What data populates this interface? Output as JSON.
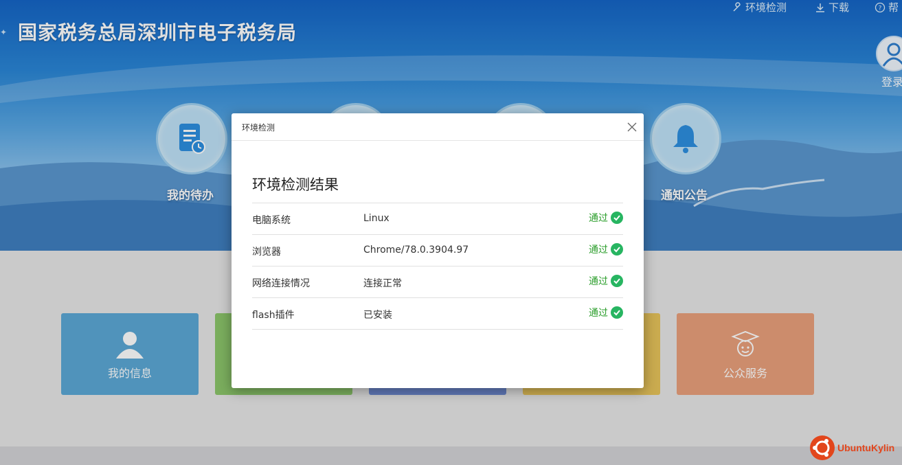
{
  "header": {
    "site_title": "国家税务总局深圳市电子税务局",
    "links": [
      {
        "label": "环境检测",
        "icon": "wrench-icon"
      },
      {
        "label": "下载",
        "icon": "download-icon"
      },
      {
        "label": "帮",
        "icon": "help-icon"
      }
    ],
    "login_label": "登录"
  },
  "shortcuts": [
    {
      "label": "我的待办",
      "icon": "document-clock-icon"
    },
    {
      "label": "",
      "icon": "hidden-shortcut-icon"
    },
    {
      "label": "",
      "icon": "hidden-shortcut-icon"
    },
    {
      "label": "通知公告",
      "icon": "bell-icon"
    }
  ],
  "tiles": [
    {
      "label": "我的信息",
      "color": "#5ca8d5",
      "icon": "user-icon"
    },
    {
      "label": "",
      "color": "#8bc56a"
    },
    {
      "label": "",
      "color": "#6d88cf"
    },
    {
      "label": "",
      "color": "#e6c35a"
    },
    {
      "label": "公众服务",
      "color": "#e9a07c",
      "icon": "graduate-icon"
    }
  ],
  "dialog": {
    "title": "环境检测",
    "result_title": "环境检测结果",
    "rows": [
      {
        "name": "电脑系统",
        "value": "Linux",
        "status": "通过"
      },
      {
        "name": "浏览器",
        "value": "Chrome/78.0.3904.97",
        "status": "通过"
      },
      {
        "name": "网络连接情况",
        "value": "连接正常",
        "status": "通过"
      },
      {
        "name": "flash插件",
        "value": "已安装",
        "status": "通过"
      }
    ]
  },
  "desktop": {
    "brand": "UbuntuKylin",
    "brand_color": "#e2461c"
  }
}
